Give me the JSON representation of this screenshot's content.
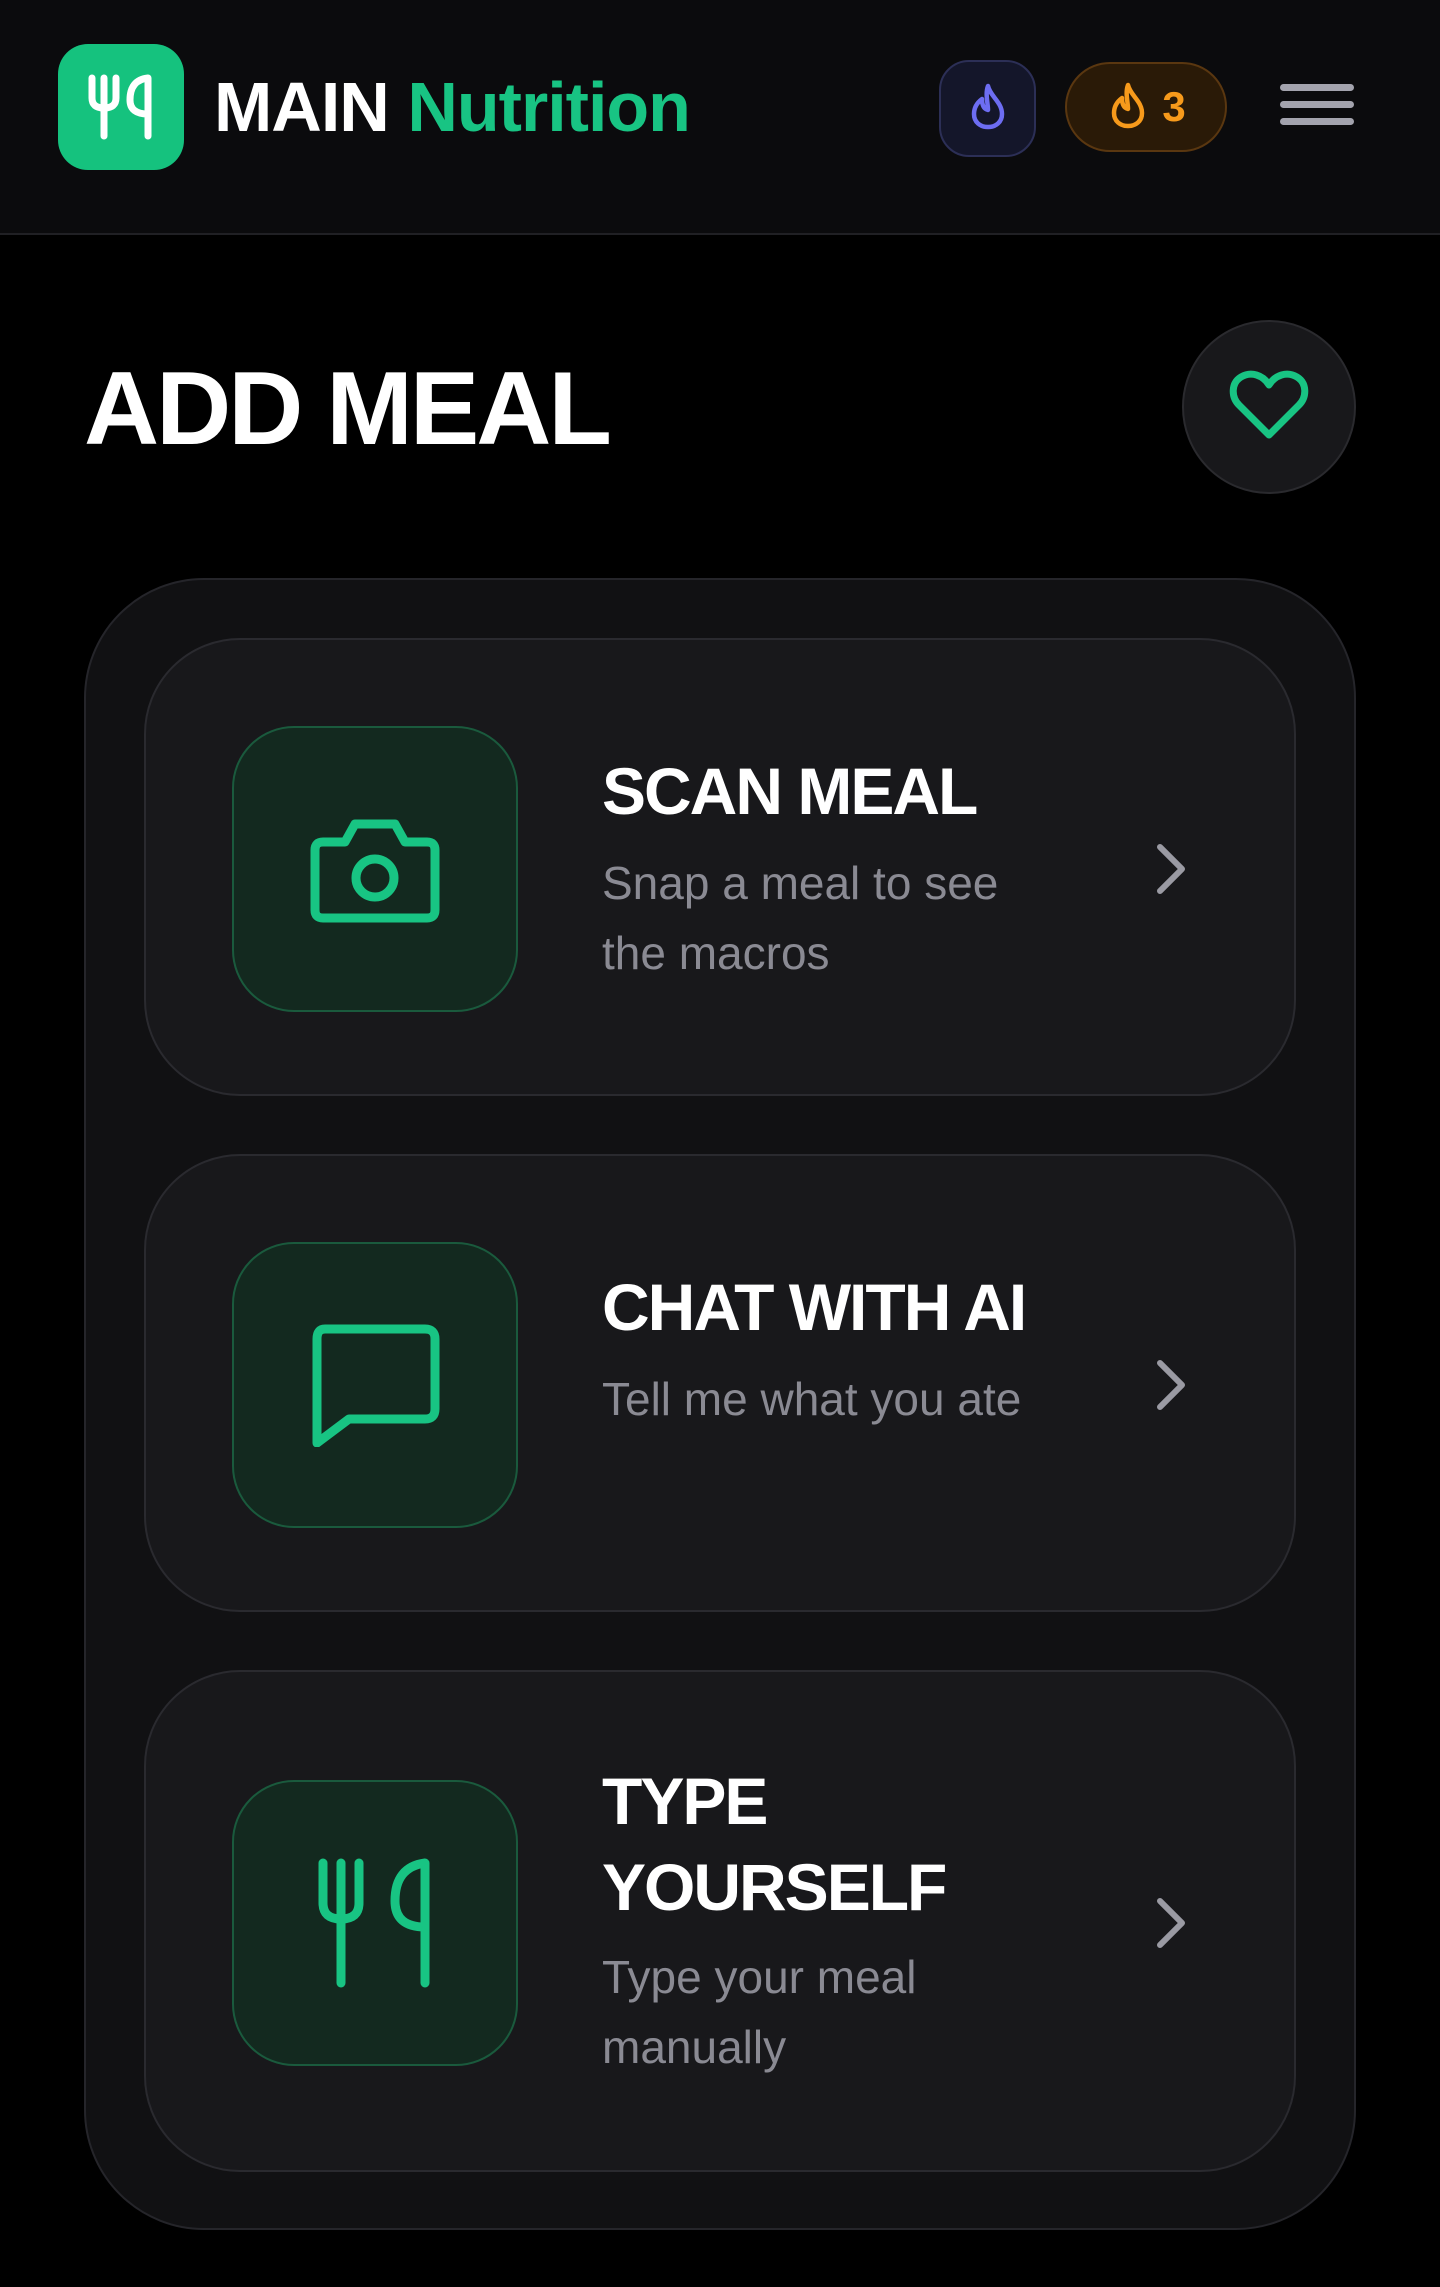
{
  "header": {
    "brand_main": "MAIN",
    "brand_accent": "Nutrition",
    "logo_icon": "fork-knife-icon",
    "drop_icon": "flame-icon",
    "streak_icon": "flame-icon",
    "streak_count": "3",
    "menu_icon": "hamburger-menu-icon"
  },
  "page": {
    "title": "ADD MEAL",
    "favorites_icon": "heart-icon"
  },
  "options": [
    {
      "id": "scan",
      "title": "SCAN MEAL",
      "description": "Snap a meal to see the macros",
      "icon": "camera-icon"
    },
    {
      "id": "chat",
      "title": "CHAT WITH AI",
      "description": "Tell me what you ate",
      "icon": "chat-bubble-icon"
    },
    {
      "id": "type",
      "title": "TYPE YOURSELF",
      "description": "Type your meal manually",
      "icon": "fork-knife-icon"
    }
  ],
  "colors": {
    "accent_green": "#18c483",
    "streak_orange": "#f79a1b",
    "drop_purple": "#6d6df2",
    "background": "#000000"
  }
}
